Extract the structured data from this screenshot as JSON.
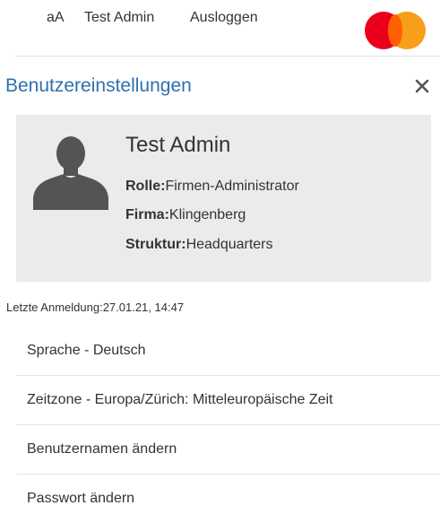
{
  "header": {
    "font_size_toggle": "aA",
    "username": "Test Admin",
    "logout_label": "Ausloggen",
    "logo_colors": {
      "left": "#eb001b",
      "right": "#f79e1b",
      "overlap": "#ff5f00"
    }
  },
  "panel": {
    "title": "Benutzereinstellungen",
    "close_icon": "close-icon",
    "accent_color": "#2f6fad"
  },
  "user_card": {
    "name": "Test Admin",
    "role_label": "Rolle:",
    "role_value": "Firmen-Administrator",
    "company_label": "Firma:",
    "company_value": "Klingenberg",
    "structure_label": "Struktur:",
    "structure_value": "Headquarters",
    "avatar_icon": "user-silhouette-icon"
  },
  "last_login": "Letzte Anmeldung:27.01.21, 14:47",
  "menu": {
    "items": [
      {
        "label": "Sprache - Deutsch"
      },
      {
        "label": "Zeitzone - Europa/Zürich: Mitteleuropäische Zeit"
      },
      {
        "label": "Benutzernamen ändern"
      },
      {
        "label": "Passwort ändern"
      }
    ]
  }
}
